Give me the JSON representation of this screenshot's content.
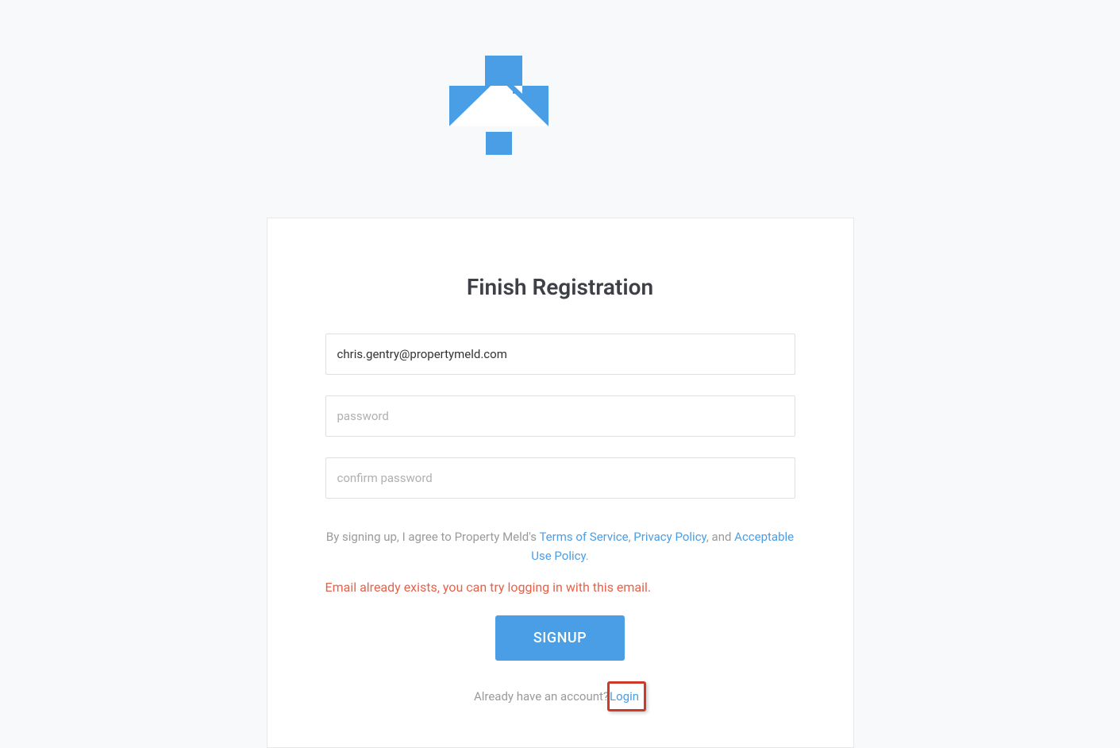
{
  "title": "Finish Registration",
  "form": {
    "email_value": "chris.gentry@propertymeld.com",
    "password_placeholder": "password",
    "confirm_password_placeholder": "confirm password"
  },
  "terms": {
    "prefix": "By signing up, I agree to Property Meld's ",
    "tos_label": "Terms of Service",
    "sep1": ", ",
    "privacy_label": "Privacy Policy",
    "sep2": ", and ",
    "aup_label": "Acceptable Use Policy",
    "suffix": "."
  },
  "error_message": "Email already exists, you can try logging in with this email.",
  "signup_button_label": "SIGNUP",
  "login_prompt": {
    "prefix": "Already have an account?",
    "login_label": " Login"
  }
}
